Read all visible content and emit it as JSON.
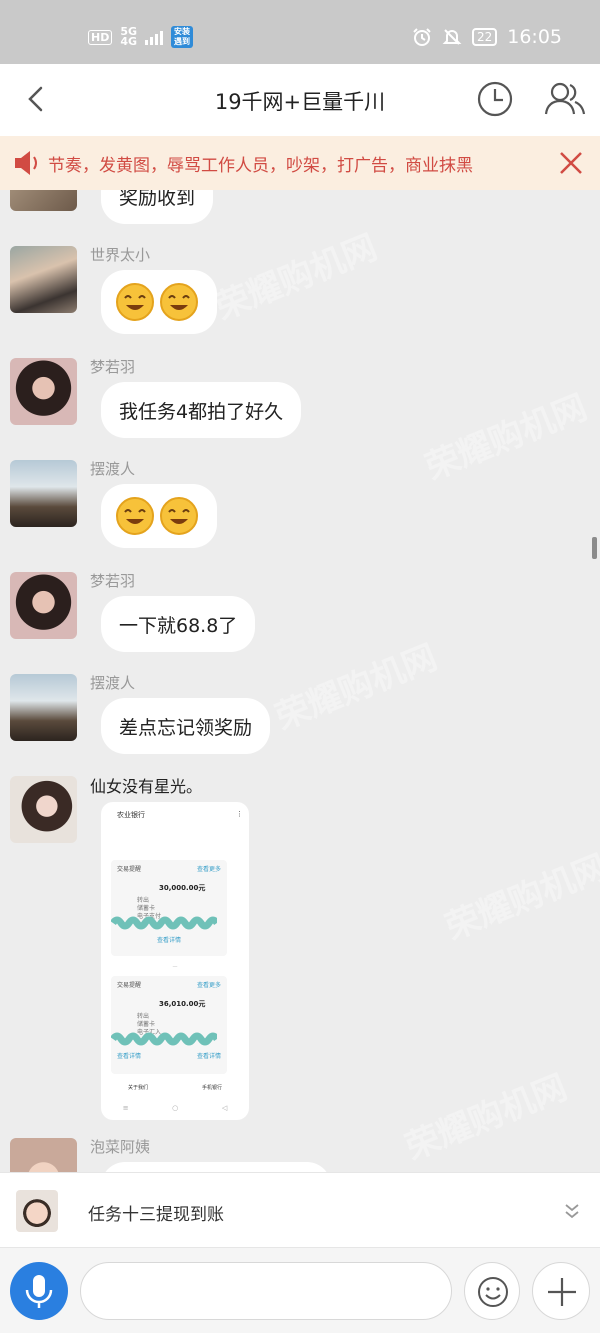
{
  "status_bar": {
    "hd": "HD",
    "network_top": "5G",
    "network_bottom": "4G",
    "app_badge": "安装 遇到",
    "alarm_icon": "alarm-clock-icon",
    "mute_icon": "bell-off-icon",
    "battery": "22",
    "time": "16:05",
    "watermark": "荣耀购机网"
  },
  "header": {
    "title": "19千网+巨量千川",
    "back_icon": "chevron-left-icon",
    "history_icon": "clock-icon",
    "members_icon": "group-members-icon"
  },
  "notice": {
    "text": "节奏，发黄图，辱骂工作人员，吵架，打广告，商业抹黑",
    "close_icon": "close-icon",
    "accent_color": "#d14b43"
  },
  "messages": [
    {
      "sender": "",
      "text": "奖励收到",
      "type": "text"
    },
    {
      "sender": "世界太小",
      "emoji": [
        "smile-emoji-icon",
        "smile-emoji-icon"
      ],
      "type": "emoji"
    },
    {
      "sender": "梦若羽",
      "text": "我任务4都拍了好久",
      "type": "text"
    },
    {
      "sender": "摆渡人",
      "emoji": [
        "smile-emoji-icon",
        "smile-emoji-icon"
      ],
      "type": "emoji"
    },
    {
      "sender": "梦若羽",
      "text": "一下就68.8了",
      "type": "text"
    },
    {
      "sender": "摆渡人",
      "text": "差点忘记领奖励",
      "type": "text"
    },
    {
      "sender": "仙女没有星光。",
      "type": "image",
      "screenshot": {
        "bank": "农业银行",
        "card1": {
          "title": "交易提醒",
          "link": "查看更多",
          "amount": "30,000.00元",
          "rows": [
            "转出",
            "储蓄卡",
            "电子支付"
          ],
          "footer": "查看详情"
        },
        "card2": {
          "title": "交易提醒",
          "link": "查看更多",
          "amount": "36,010.00元",
          "rows": [
            "转出",
            "储蓄卡",
            "电子汇入"
          ],
          "footer_left": "查看详情",
          "footer_right": "查看详情"
        },
        "bottom_left": "关于我们",
        "bottom_right": "手机银行"
      }
    },
    {
      "sender": "泡菜阿姨",
      "type": "text",
      "text": ""
    }
  ],
  "pinned": {
    "text": "任务十三提现到账",
    "expand_icon": "double-chevron-down-icon"
  },
  "input_bar": {
    "mic_icon": "microphone-icon",
    "placeholder": "",
    "emoji_icon": "smiley-icon",
    "plus_icon": "plus-icon",
    "mic_color": "#2a7fe0"
  }
}
